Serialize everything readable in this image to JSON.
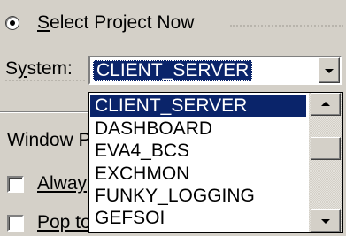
{
  "radio": {
    "label": "Select Project Now",
    "checked": true
  },
  "system": {
    "label": "System:",
    "selected": "CLIENT_SERVER",
    "options": [
      "CLIENT_SERVER",
      "DASHBOARD",
      "EVA4_BCS",
      "EXCHMON",
      "FUNKY_LOGGING",
      "GEFSOI"
    ]
  },
  "window_group": {
    "label": "Window P"
  },
  "checkboxes": [
    {
      "label": "Alway"
    },
    {
      "label": "Pop to"
    }
  ],
  "colors": {
    "highlight": "#0a246a",
    "face": "#d4d0c8"
  }
}
